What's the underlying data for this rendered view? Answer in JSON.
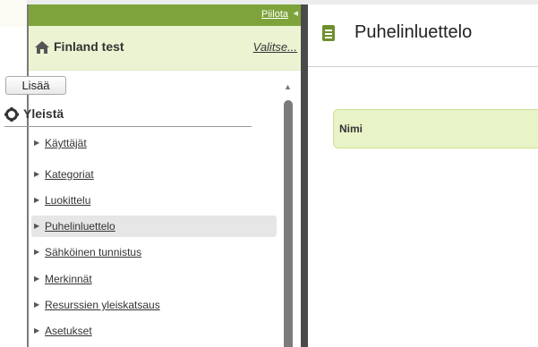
{
  "sidebar": {
    "hide_label": "Piilota",
    "org_name": "Finland test",
    "select_label": "Valitse...",
    "add_label": "Lisää",
    "section_title": "Yleistä",
    "items": [
      {
        "label": "Käyttäjät",
        "active": false
      },
      {
        "label": "Kategoriat",
        "active": false
      },
      {
        "label": "Luokittelu",
        "active": false
      },
      {
        "label": "Puhelinluettelo",
        "active": true
      },
      {
        "label": "Sähköinen tunnistus",
        "active": false
      },
      {
        "label": "Merkinnät",
        "active": false
      },
      {
        "label": "Resurssien yleiskatsaus",
        "active": false
      },
      {
        "label": "Asetukset",
        "active": false
      }
    ]
  },
  "main": {
    "title": "Puhelinluettelo",
    "table": {
      "columns": [
        "Nimi"
      ]
    }
  },
  "icons": {
    "hide_arrow": "triangle-left-icon",
    "home": "home-icon",
    "section": "gear-icon",
    "page": "document-icon",
    "nav_arrow": "triangle-right-icon"
  },
  "colors": {
    "accent": "#7ea33c",
    "header_bg": "#ecf3d2",
    "table_header_bg": "#e9f3c8",
    "active_item_bg": "#e6e6e6"
  }
}
